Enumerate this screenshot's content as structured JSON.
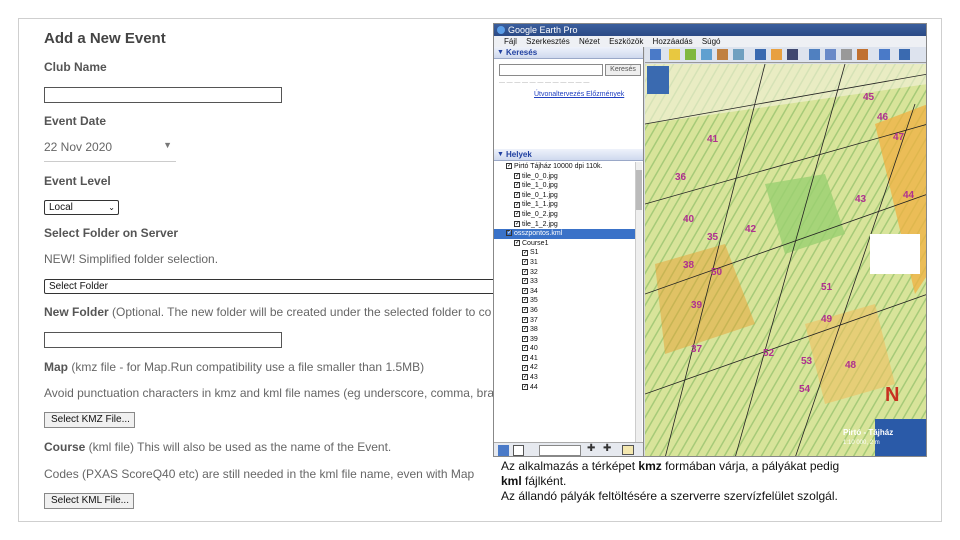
{
  "form": {
    "title": "Add a New Event",
    "club_name_label": "Club Name",
    "club_name_value": "",
    "event_date_label": "Event Date",
    "event_date_value": "22 Nov 2020",
    "event_level_label": "Event Level",
    "event_level_value": "Local",
    "select_folder_label": "Select Folder on Server",
    "simplified_note": "NEW!   Simplified folder selection.",
    "select_folder_value": "Select Folder",
    "new_folder_label": "New Folder",
    "new_folder_hint": " (Optional. The new folder will be created under the selected folder to co",
    "map_label": "Map",
    "map_hint": " (kmz file - for Map.Run compatibility use a file smaller than 1.5MB)",
    "punctuation_note": "Avoid punctuation characters in kmz and kml file names (eg underscore, comma, bra",
    "select_kmz_button": "Select KMZ File...",
    "course_label": "Course",
    "course_hint": " (kml file) This will also be used as the name of the Event.",
    "codes_note": "Codes (PXAS ScoreQ40 etc) are still needed in the kml file name, even with Map",
    "select_kml_button": "Select KML File..."
  },
  "google_earth": {
    "window_title": "Google Earth Pro",
    "menu": [
      "Fájl",
      "Szerkesztés",
      "Nézet",
      "Eszközök",
      "Hozzáadás",
      "Súgó"
    ],
    "search_header": "Keresés",
    "search_button": "Keresés",
    "search_links": "Útvonaltervezés   Előzmények",
    "places_header": "Helyek",
    "places": [
      {
        "label": "Pirtó Tájház 10000 dpi 110k.",
        "checked": true,
        "indent": 1
      },
      {
        "label": "tile_0_0.jpg",
        "checked": true,
        "indent": 2
      },
      {
        "label": "tile_1_0.jpg",
        "checked": true,
        "indent": 2
      },
      {
        "label": "tile_0_1.jpg",
        "checked": true,
        "indent": 2
      },
      {
        "label": "tile_1_1.jpg",
        "checked": true,
        "indent": 2
      },
      {
        "label": "tile_0_2.jpg",
        "checked": true,
        "indent": 2
      },
      {
        "label": "tile_1_2.jpg",
        "checked": true,
        "indent": 2
      },
      {
        "label": "osszpontos.kml",
        "checked": true,
        "indent": 1,
        "selected": true
      },
      {
        "label": "Course1",
        "checked": true,
        "indent": 2
      },
      {
        "label": "S1",
        "checked": true,
        "indent": 3
      },
      {
        "label": "31",
        "checked": true,
        "indent": 3
      },
      {
        "label": "32",
        "checked": true,
        "indent": 3
      },
      {
        "label": "33",
        "checked": true,
        "indent": 3
      },
      {
        "label": "34",
        "checked": true,
        "indent": 3
      },
      {
        "label": "35",
        "checked": true,
        "indent": 3
      },
      {
        "label": "36",
        "checked": true,
        "indent": 3
      },
      {
        "label": "37",
        "checked": true,
        "indent": 3
      },
      {
        "label": "38",
        "checked": true,
        "indent": 3
      },
      {
        "label": "39",
        "checked": true,
        "indent": 3
      },
      {
        "label": "40",
        "checked": true,
        "indent": 3
      },
      {
        "label": "41",
        "checked": true,
        "indent": 3
      },
      {
        "label": "42",
        "checked": true,
        "indent": 3
      },
      {
        "label": "43",
        "checked": true,
        "indent": 3
      },
      {
        "label": "44",
        "checked": true,
        "indent": 3
      }
    ],
    "map_title": "Pirtó - Tájház",
    "map_scale": "1:10 000, 2 m",
    "map_controls": [
      "46",
      "45",
      "47",
      "41",
      "36",
      "43",
      "44",
      "40",
      "42",
      "35",
      "38",
      "50",
      "51",
      "49",
      "39",
      "37",
      "52",
      "53",
      "48",
      "54"
    ]
  },
  "caption": {
    "line1_a": "Az alkalmazás a térképet ",
    "line1_b": "kmz",
    "line1_c": " formában várja, a pályákat pedig",
    "line2_a": "kml",
    "line2_b": " fájlként.",
    "line3": "Az állandó pályák feltöltésére a szerverre szervízfelület szolgál."
  }
}
